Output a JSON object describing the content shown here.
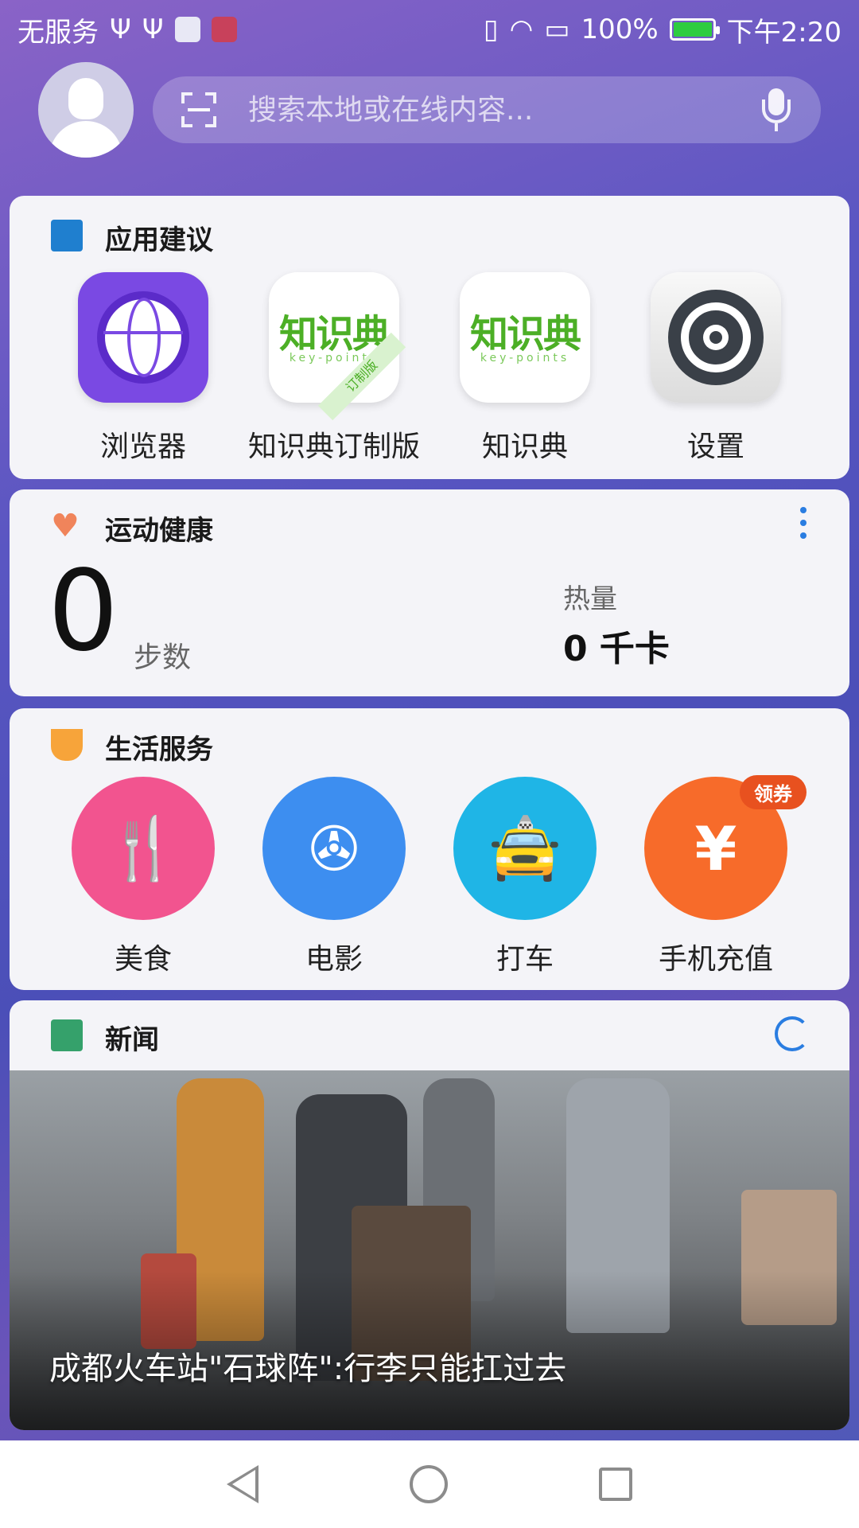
{
  "status_bar": {
    "carrier": "无服务",
    "battery": "100%",
    "time": "下午2:20",
    "icons": [
      "usb-icon",
      "usb-icon",
      "app-notification-icon",
      "huawei-notification-icon",
      "vibrate-icon",
      "wifi-icon",
      "sim-icon",
      "battery-icon"
    ]
  },
  "search": {
    "placeholder": "搜索本地或在线内容..."
  },
  "app_suggestions": {
    "title": "应用建议",
    "apps": [
      {
        "label": "浏览器",
        "icon": "browser-icon"
      },
      {
        "label": "知识典订制版",
        "icon": "zhishidian-custom-icon",
        "logo_text": "知识典",
        "logo_sub": "key-points",
        "ribbon": "订制版"
      },
      {
        "label": "知识典",
        "icon": "zhishidian-icon",
        "logo_text": "知识典",
        "logo_sub": "key-points"
      },
      {
        "label": "设置",
        "icon": "settings-icon"
      }
    ]
  },
  "health": {
    "title": "运动健康",
    "steps_value": "0",
    "steps_label": "步数",
    "calories_label": "热量",
    "calories_value": "0 千卡"
  },
  "life_services": {
    "title": "生活服务",
    "items": [
      {
        "label": "美食",
        "icon": "food-icon",
        "color": "#f2548f"
      },
      {
        "label": "电影",
        "icon": "movie-icon",
        "color": "#3d8ef0"
      },
      {
        "label": "打车",
        "icon": "taxi-icon",
        "color": "#1fb5e6"
      },
      {
        "label": "手机充值",
        "icon": "phone-recharge-icon",
        "color": "#f76b2a",
        "badge": "领券"
      }
    ]
  },
  "news": {
    "title": "新闻",
    "headline": "成都火车站\"石球阵\":行李只能扛过去"
  },
  "colors": {
    "accent": "#2a7de1",
    "green_brand": "#4caf26"
  }
}
